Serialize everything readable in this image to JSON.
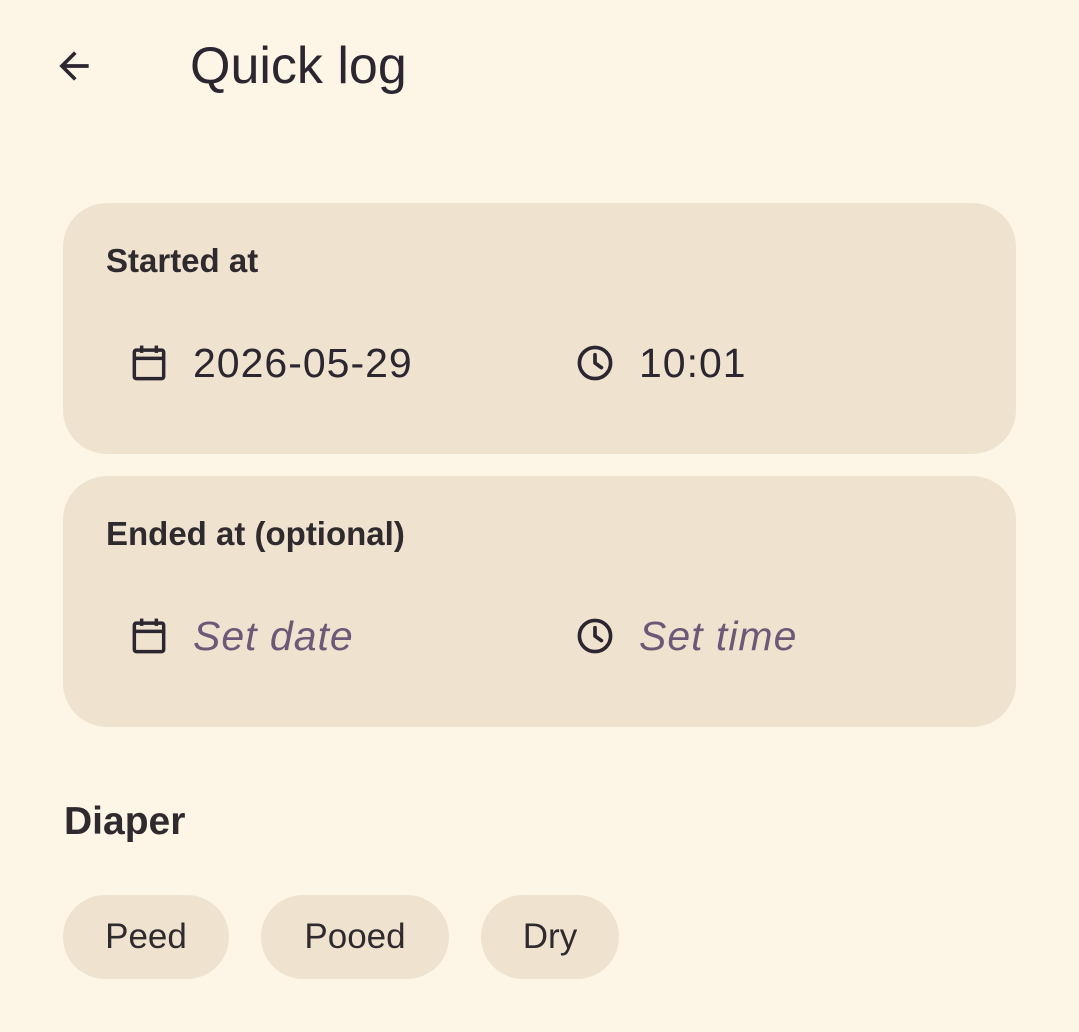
{
  "app_bar": {
    "title": "Quick log",
    "back_icon": "arrow-back-icon"
  },
  "started": {
    "title": "Started at",
    "date_value": "2026-05-29",
    "time_value": "10:01",
    "date_icon": "calendar-icon",
    "time_icon": "clock-icon"
  },
  "ended": {
    "title": "Ended at (optional)",
    "date_placeholder": "Set date",
    "time_placeholder": "Set time",
    "date_icon": "calendar-icon",
    "time_icon": "clock-icon"
  },
  "diaper": {
    "title": "Diaper",
    "options": [
      {
        "label": "Peed"
      },
      {
        "label": "Pooed"
      },
      {
        "label": "Dry"
      }
    ]
  },
  "colors": {
    "background": "#fdf5e6",
    "card": "#efe3d0",
    "text": "#2b2630",
    "placeholder": "#6e5878"
  }
}
